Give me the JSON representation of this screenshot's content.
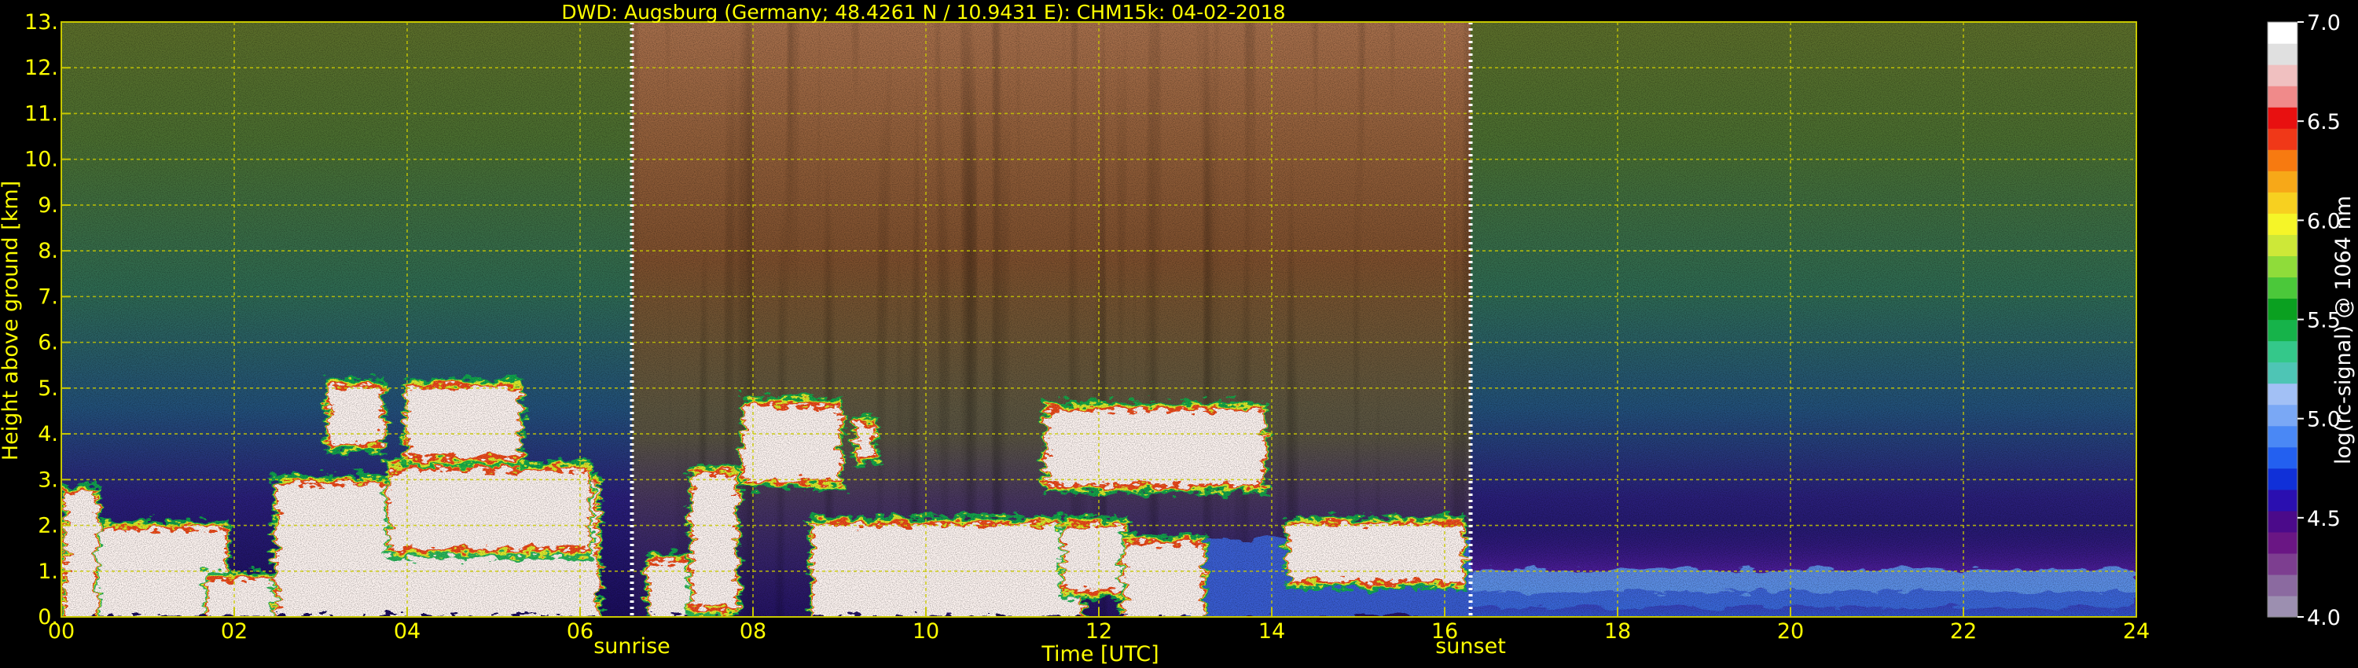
{
  "chart_data": {
    "type": "heatmap",
    "title": "DWD: Augsburg (Germany; 48.4261 N / 10.9431 E):    CHM15k: 04-02-2018",
    "xlabel": "Time [UTC]",
    "ylabel": "Height above ground [km]",
    "xlim": [
      0,
      24
    ],
    "ylim": [
      0,
      13
    ],
    "xticks": [
      "00",
      "02",
      "04",
      "06",
      "08",
      "10",
      "12",
      "14",
      "16",
      "18",
      "20",
      "22",
      "24"
    ],
    "yticks": [
      "0.",
      "1.",
      "2.",
      "3.",
      "4.",
      "5.",
      "6.",
      "7.",
      "8.",
      "9.",
      "10.",
      "11.",
      "12.",
      "13."
    ],
    "grid": true,
    "annotations": [
      {
        "label": "sunrise",
        "x": 6.6
      },
      {
        "label": "sunset",
        "x": 16.3
      }
    ],
    "colorbar": {
      "label": "log(rc-signal) @ 1064 nm",
      "min": 4.0,
      "max": 7.0,
      "ticks": [
        "4.0",
        "4.5",
        "5.0",
        "5.5",
        "6.0",
        "6.5",
        "7.0"
      ],
      "colors": [
        "#9c8fb0",
        "#8b6aa0",
        "#7d3e90",
        "#6a1684",
        "#4b0a8a",
        "#2a0fb0",
        "#1030d8",
        "#2360f0",
        "#4a88f5",
        "#7aa8f5",
        "#a2c0f5",
        "#4ec5b5",
        "#34c88a",
        "#16b34a",
        "#0aa020",
        "#4bc83a",
        "#8fdc3a",
        "#cde838",
        "#f5f528",
        "#f7d020",
        "#f7a818",
        "#f77a10",
        "#f03818",
        "#e81010",
        "#f08a8a",
        "#f0c0c0",
        "#e0e0e0",
        "#ffffff"
      ]
    },
    "palette": {
      "background": "#000000",
      "text": "#ffff00",
      "grid": "#c8c800",
      "marker": "#ffffff"
    }
  }
}
